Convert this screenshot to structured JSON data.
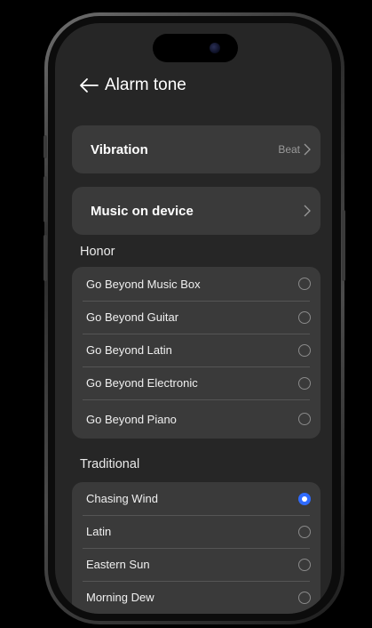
{
  "header": {
    "title": "Alarm tone"
  },
  "settings": {
    "vibration": {
      "label": "Vibration",
      "value": "Beat"
    },
    "music_on_device": {
      "label": "Music on device"
    }
  },
  "sections": [
    {
      "title": "Honor",
      "items": [
        {
          "label": "Go Beyond Music Box",
          "selected": false
        },
        {
          "label": "Go Beyond Guitar",
          "selected": false
        },
        {
          "label": "Go Beyond Latin",
          "selected": false
        },
        {
          "label": "Go Beyond Electronic",
          "selected": false
        },
        {
          "label": "Go Beyond Piano",
          "selected": false
        }
      ]
    },
    {
      "title": "Traditional",
      "items": [
        {
          "label": "Chasing Wind",
          "selected": true
        },
        {
          "label": "Latin",
          "selected": false
        },
        {
          "label": "Eastern Sun",
          "selected": false
        },
        {
          "label": "Morning Dew",
          "selected": false
        }
      ]
    }
  ],
  "colors": {
    "accent": "#2f6bff",
    "background": "#262626",
    "card": "#3a3a3a"
  }
}
